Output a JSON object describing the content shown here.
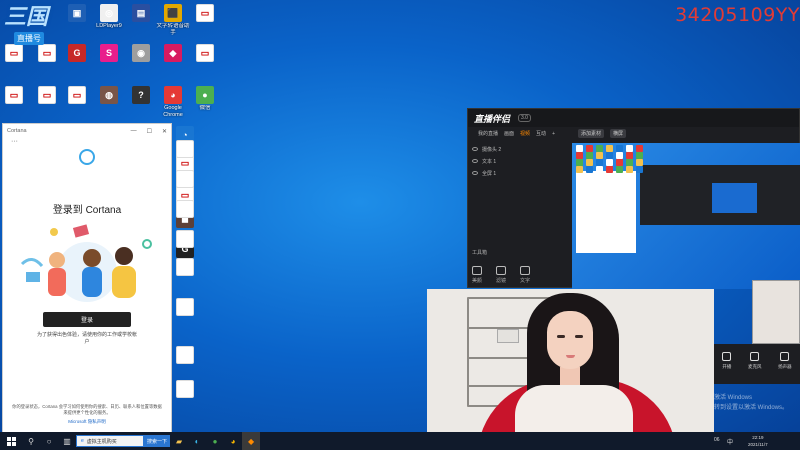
{
  "watermark_id": "34205109YY",
  "logo": {
    "main": "三国",
    "sub": "直播号"
  },
  "desktop_icons": [
    {
      "label": "",
      "color": "#1e5fb4",
      "glyph": "▣",
      "pdf": false
    },
    {
      "label": "LDPlayer9",
      "color": "#f0f0f0",
      "glyph": "◎",
      "pdf": false
    },
    {
      "label": "",
      "color": "#2a4fa0",
      "glyph": "▤",
      "pdf": false
    },
    {
      "label": "文字转语音助手",
      "color": "#e2a800",
      "glyph": "⬛",
      "pdf": false
    },
    {
      "label": "",
      "color": "#ffffff",
      "glyph": "▭",
      "pdf": true
    },
    {
      "label": "",
      "color": "#ffffff",
      "glyph": "▭",
      "pdf": true
    },
    {
      "label": "",
      "color": "#ffffff",
      "glyph": "▭",
      "pdf": true
    },
    {
      "label": "",
      "color": "#c62828",
      "glyph": "G",
      "pdf": false
    },
    {
      "label": "",
      "color": "#e91e8c",
      "glyph": "S",
      "pdf": false
    },
    {
      "label": "",
      "color": "#9e9e9e",
      "glyph": "◉",
      "pdf": false
    },
    {
      "label": "",
      "color": "#d81b60",
      "glyph": "◆",
      "pdf": false
    },
    {
      "label": "",
      "color": "#ffffff",
      "glyph": "▭",
      "pdf": true
    },
    {
      "label": "",
      "color": "#ffffff",
      "glyph": "▭",
      "pdf": true
    },
    {
      "label": "",
      "color": "#ffffff",
      "glyph": "▭",
      "pdf": true
    },
    {
      "label": "",
      "color": "#ffffff",
      "glyph": "▭",
      "pdf": true
    },
    {
      "label": "",
      "color": "#795548",
      "glyph": "◍",
      "pdf": false
    },
    {
      "label": "",
      "color": "#333333",
      "glyph": "?",
      "pdf": false
    },
    {
      "label": "Google Chrome",
      "color": "#e53935",
      "glyph": "◕",
      "pdf": false
    },
    {
      "label": "微信",
      "color": "#4caf50",
      "glyph": "●",
      "pdf": false
    },
    {
      "label": "",
      "color": "#1976d2",
      "glyph": "◔",
      "pdf": false
    },
    {
      "label": "",
      "color": "#ffffff",
      "glyph": "▭",
      "pdf": true
    },
    {
      "label": "",
      "color": "#ffffff",
      "glyph": "▭",
      "pdf": true
    },
    {
      "label": "",
      "color": "#5d4037",
      "glyph": "◼",
      "pdf": false
    },
    {
      "label": "",
      "color": "#212121",
      "glyph": "G",
      "pdf": false
    }
  ],
  "cortana": {
    "title": "Cortana",
    "heading": "登录到 Cortana",
    "signin_label": "登录",
    "description": "为了获得出色体验，请使用你的工作或学校帐户",
    "footer": "你的登录状态，Cortana 会学习如何使用你的搜索、日历、联系人和位置等数据来提供更个性化的服务。",
    "privacy_link": "Microsoft 隐私声明",
    "min": "—",
    "max": "☐",
    "close": "✕",
    "more": "···"
  },
  "stream_app": {
    "logo": "直播伴侣",
    "badge": "3.0",
    "tabs": [
      "我的直播",
      "画面",
      "视频",
      "互动",
      "+"
    ],
    "active_tab_index": 2,
    "scenes": [
      "摄像头 2",
      "文本 1",
      "全屏 1"
    ],
    "preview_bar": [
      "添加素材",
      "横屏"
    ],
    "tools_title": "工具箱",
    "tools": [
      "美颜",
      "滤镜",
      "文字"
    ]
  },
  "controls": [
    {
      "label": "开播"
    },
    {
      "label": "麦克风"
    },
    {
      "label": "扬声器"
    }
  ],
  "activation": {
    "line1": "激活 Windows",
    "line2": "转到设置以激活 Windows。"
  },
  "taskbar": {
    "search_placeholder": "虚拟主机购买",
    "search_button": "搜索一下",
    "num": "06",
    "lang": "中",
    "time": "22:19",
    "date": "2021/11/7"
  }
}
